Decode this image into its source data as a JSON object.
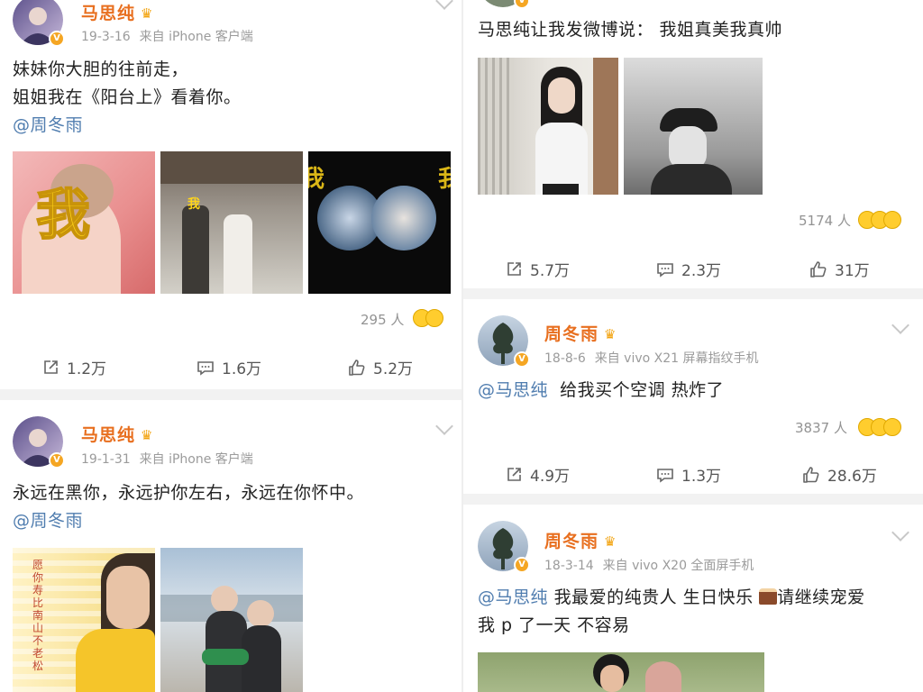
{
  "left": {
    "post1": {
      "username": "马思纯",
      "date": "19-3-16",
      "source": "来自 iPhone 客户端",
      "text_line1": "妹妹你大胆的往前走，",
      "text_line2": "姐姐我在《阳台上》看着你。",
      "mention": "@周冬雨",
      "image1_overlay": "我",
      "image2_overlay": "我",
      "likes_count": "295 人",
      "repost": "1.2万",
      "comment": "1.6万",
      "like": "5.2万"
    },
    "post2": {
      "username": "马思纯",
      "date": "19-1-31",
      "source": "来自 iPhone 客户端",
      "text_line1": "永远在黑你，永远护你左右，永远在你怀中。",
      "mention": "@周冬雨"
    }
  },
  "right": {
    "post1": {
      "text": "马思纯让我发微博说： 我姐真美我真帅",
      "likes_count": "5174 人",
      "repost": "5.7万",
      "comment": "2.3万",
      "like": "31万"
    },
    "post2": {
      "username": "周冬雨",
      "date": "18-8-6",
      "source": "来自 vivo X21 屏幕指纹手机",
      "mention": "@马思纯",
      "text": "给我买个空调 热炸了",
      "likes_count": "3837 人",
      "repost": "4.9万",
      "comment": "1.3万",
      "like": "28.6万"
    },
    "post3": {
      "username": "周冬雨",
      "date": "18-3-14",
      "source": "来自 vivo X20 全面屏手机",
      "mention": "@马思纯",
      "text_line1_a": "我最爱的纯贵人 生日快乐",
      "text_line1_b": "请继续宠爱",
      "text_line2": "我 p 了一天 不容易"
    }
  },
  "icons": {
    "repost": "repost-icon",
    "comment": "comment-icon",
    "like": "thumbs-up-icon",
    "crown": "crown-badge-icon",
    "verified": "verified-v-icon",
    "chevron": "chevron-down-icon",
    "cake": "birthday-cake-emoji"
  },
  "colors": {
    "username": "#e86f1f",
    "mention": "#507daf",
    "meta": "#9b9b9b",
    "separator": "#f2f2f2"
  }
}
